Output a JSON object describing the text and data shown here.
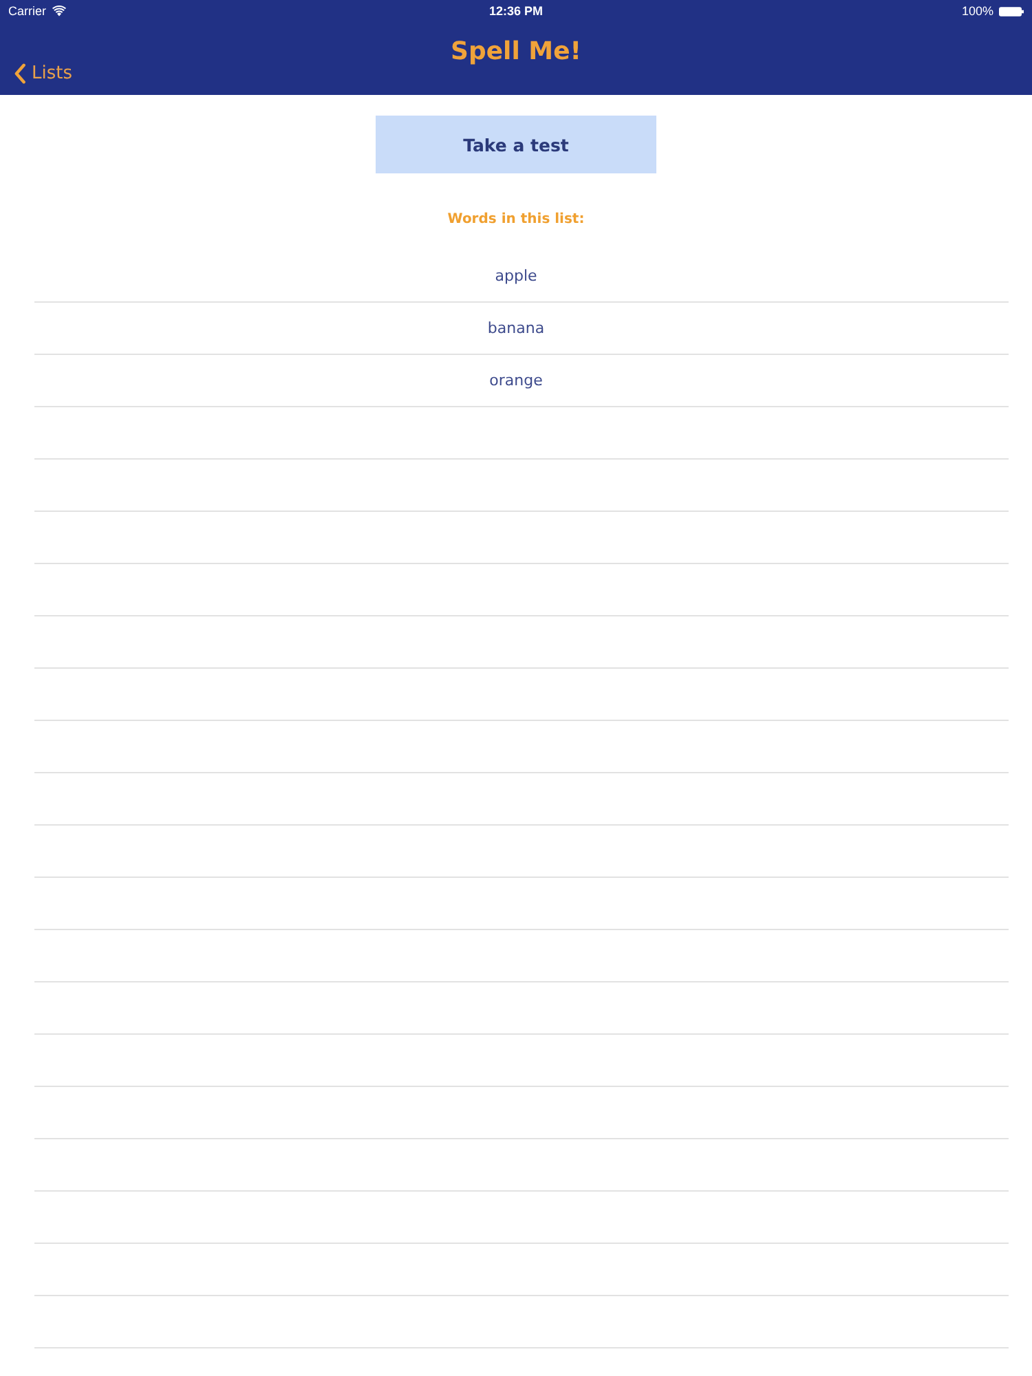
{
  "status_bar": {
    "carrier": "Carrier",
    "time": "12:36 PM",
    "battery": "100%"
  },
  "nav_bar": {
    "back_label": "Lists",
    "title": "Spell Me!"
  },
  "test_button": {
    "label": "Take a test"
  },
  "words_heading": "Words in this list:",
  "words": [
    "apple",
    "banana",
    "orange"
  ]
}
